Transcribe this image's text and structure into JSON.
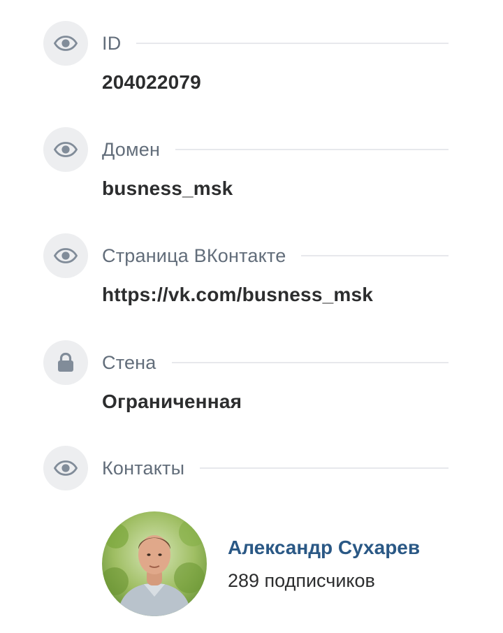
{
  "fields": [
    {
      "label": "ID",
      "value": "204022079",
      "icon": "eye-icon"
    },
    {
      "label": "Домен",
      "value": "busness_msk",
      "icon": "eye-icon"
    },
    {
      "label": "Страница ВКонтакте",
      "value": "https://vk.com/busness_msk",
      "icon": "eye-icon"
    },
    {
      "label": "Стена",
      "value": "Ограниченная",
      "icon": "lock-icon"
    }
  ],
  "contacts": {
    "label": "Контакты",
    "icon": "eye-icon",
    "items": [
      {
        "name": "Александр Сухарев",
        "subtitle": "289 подписчиков"
      }
    ]
  },
  "colors": {
    "icon_bg": "#edeef0",
    "icon_fg": "#818c99",
    "label": "#626d7a",
    "value": "#2c2d2e",
    "link": "#2a5885",
    "rule": "#e7e8ec"
  }
}
